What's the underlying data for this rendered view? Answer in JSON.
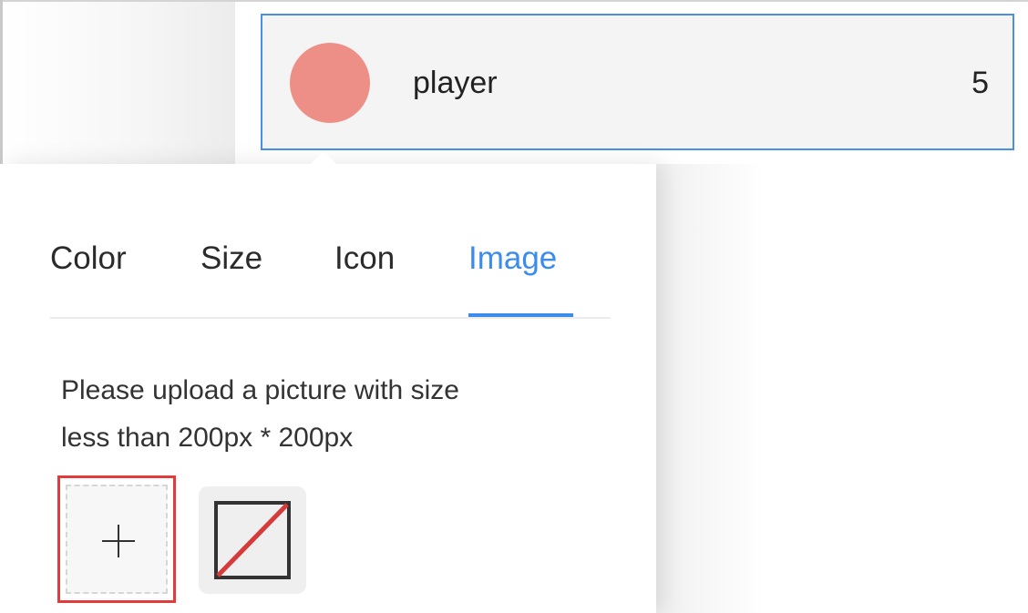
{
  "legend": {
    "item": {
      "label": "player",
      "count": "5",
      "swatch_color": "#ee8f87",
      "selected_border_color": "#4a8ee8"
    }
  },
  "popover": {
    "tabs": [
      {
        "label": "Color",
        "active": false
      },
      {
        "label": "Size",
        "active": false
      },
      {
        "label": "Icon",
        "active": false
      },
      {
        "label": "Image",
        "active": true
      }
    ],
    "accent_color": "#3b8ced",
    "image_panel": {
      "hint_line1": "Please upload a picture with size",
      "hint_line2": "less than 200px * 200px",
      "upload_icon": "plus-icon",
      "none_option_icon": "no-image-icon",
      "highlight_color": "#e23b3b"
    }
  }
}
